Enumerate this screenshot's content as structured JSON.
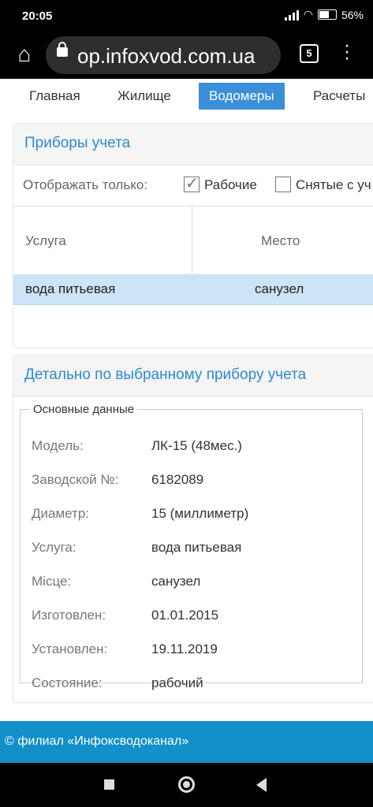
{
  "status": {
    "time": "20:05",
    "battery": "56%"
  },
  "browser": {
    "url": "op.infoxvod.com.ua",
    "tab_count": "5"
  },
  "nav": {
    "tabs": [
      "Главная",
      "Жилище",
      "Водомеры",
      "Расчеты"
    ],
    "active": "Водомеры"
  },
  "meters": {
    "title": "Приборы учета",
    "filter": {
      "label": "Отображать только:",
      "working": "Рабочие",
      "working_checked": true,
      "removed": "Снятые с уч",
      "removed_checked": false
    },
    "columns": [
      "Услуга",
      "Место"
    ],
    "rows": [
      {
        "service": "вода питьевая",
        "place": "санузел"
      }
    ]
  },
  "details": {
    "title": "Детально по выбранному прибору учета",
    "legend": "Основные данные",
    "fields": [
      {
        "label": "Модель:",
        "value": "ЛК-15 (48мес.)"
      },
      {
        "label": "Заводской №:",
        "value": "6182089"
      },
      {
        "label": "Диаметр:",
        "value": "15 (миллиметр)"
      },
      {
        "label": "Услуга:",
        "value": "вода питьевая"
      },
      {
        "label": "Місце:",
        "value": "санузел"
      },
      {
        "label": "Изготовлен:",
        "value": "01.01.2015"
      },
      {
        "label": "Установлен:",
        "value": "19.11.2019"
      },
      {
        "label": "Состояние:",
        "value": "рабочий"
      }
    ]
  },
  "footer": {
    "text": "© филиал «Инфоксводоканал»"
  }
}
